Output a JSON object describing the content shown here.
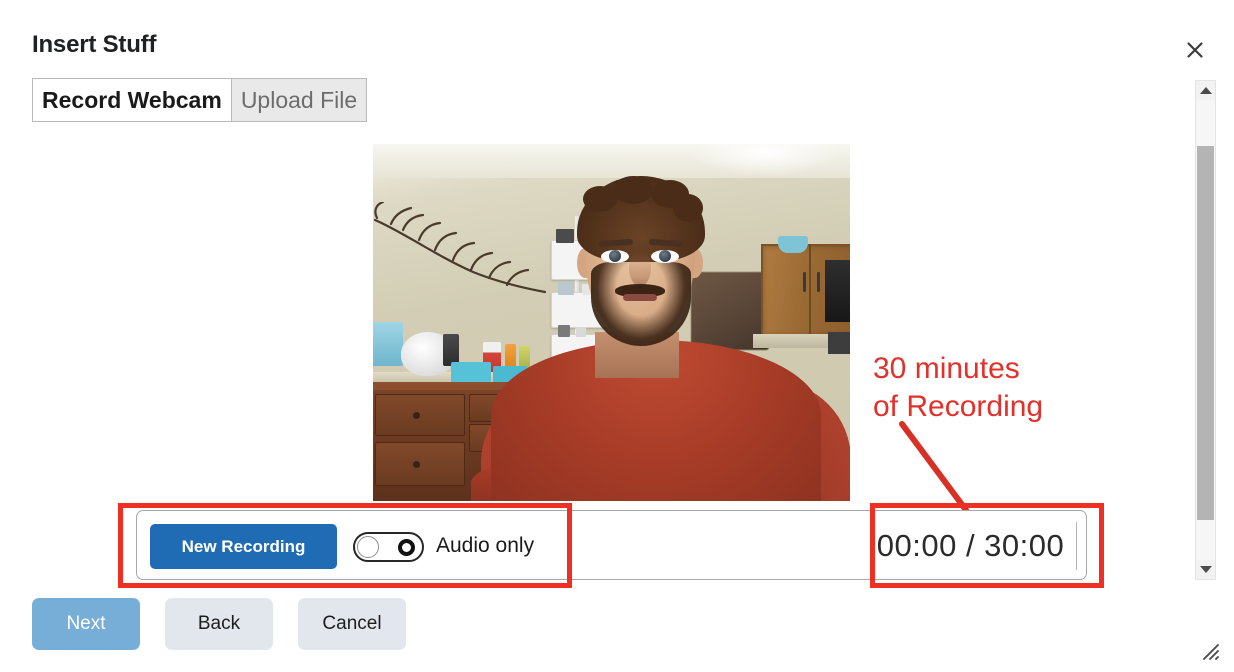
{
  "dialog": {
    "title": "Insert Stuff",
    "close_icon": "close-icon"
  },
  "tabs": [
    {
      "label": "Record Webcam",
      "active": true
    },
    {
      "label": "Upload File",
      "active": false
    }
  ],
  "video_preview": {
    "alt": "Webcam live preview of a bearded man in a dark red t-shirt seated in a kitchen with wooden cabinets, white wall shelves and a branch wall decoration"
  },
  "annotation": {
    "line1": "30 minutes",
    "line2": "of Recording",
    "color": "#e2302a",
    "pointer_icon": "arrow-line-icon"
  },
  "controls": {
    "new_recording_label": "New Recording",
    "new_recording_color": "#1f6cb5",
    "audio_only_label": "Audio only",
    "audio_only_on": false,
    "timer": "00:00 / 30:00",
    "timer_elapsed": "00:00",
    "timer_total": "30:00"
  },
  "footer": {
    "next_label": "Next",
    "next_color": "#77aed8",
    "back_label": "Back",
    "cancel_label": "Cancel",
    "secondary_color": "#e2e7ee"
  },
  "scrollbar": {
    "up_icon": "triangle-up-icon",
    "down_icon": "triangle-down-icon",
    "thumb_name": "scrollbar-thumb"
  },
  "resize": {
    "icon": "resize-grip-icon"
  }
}
